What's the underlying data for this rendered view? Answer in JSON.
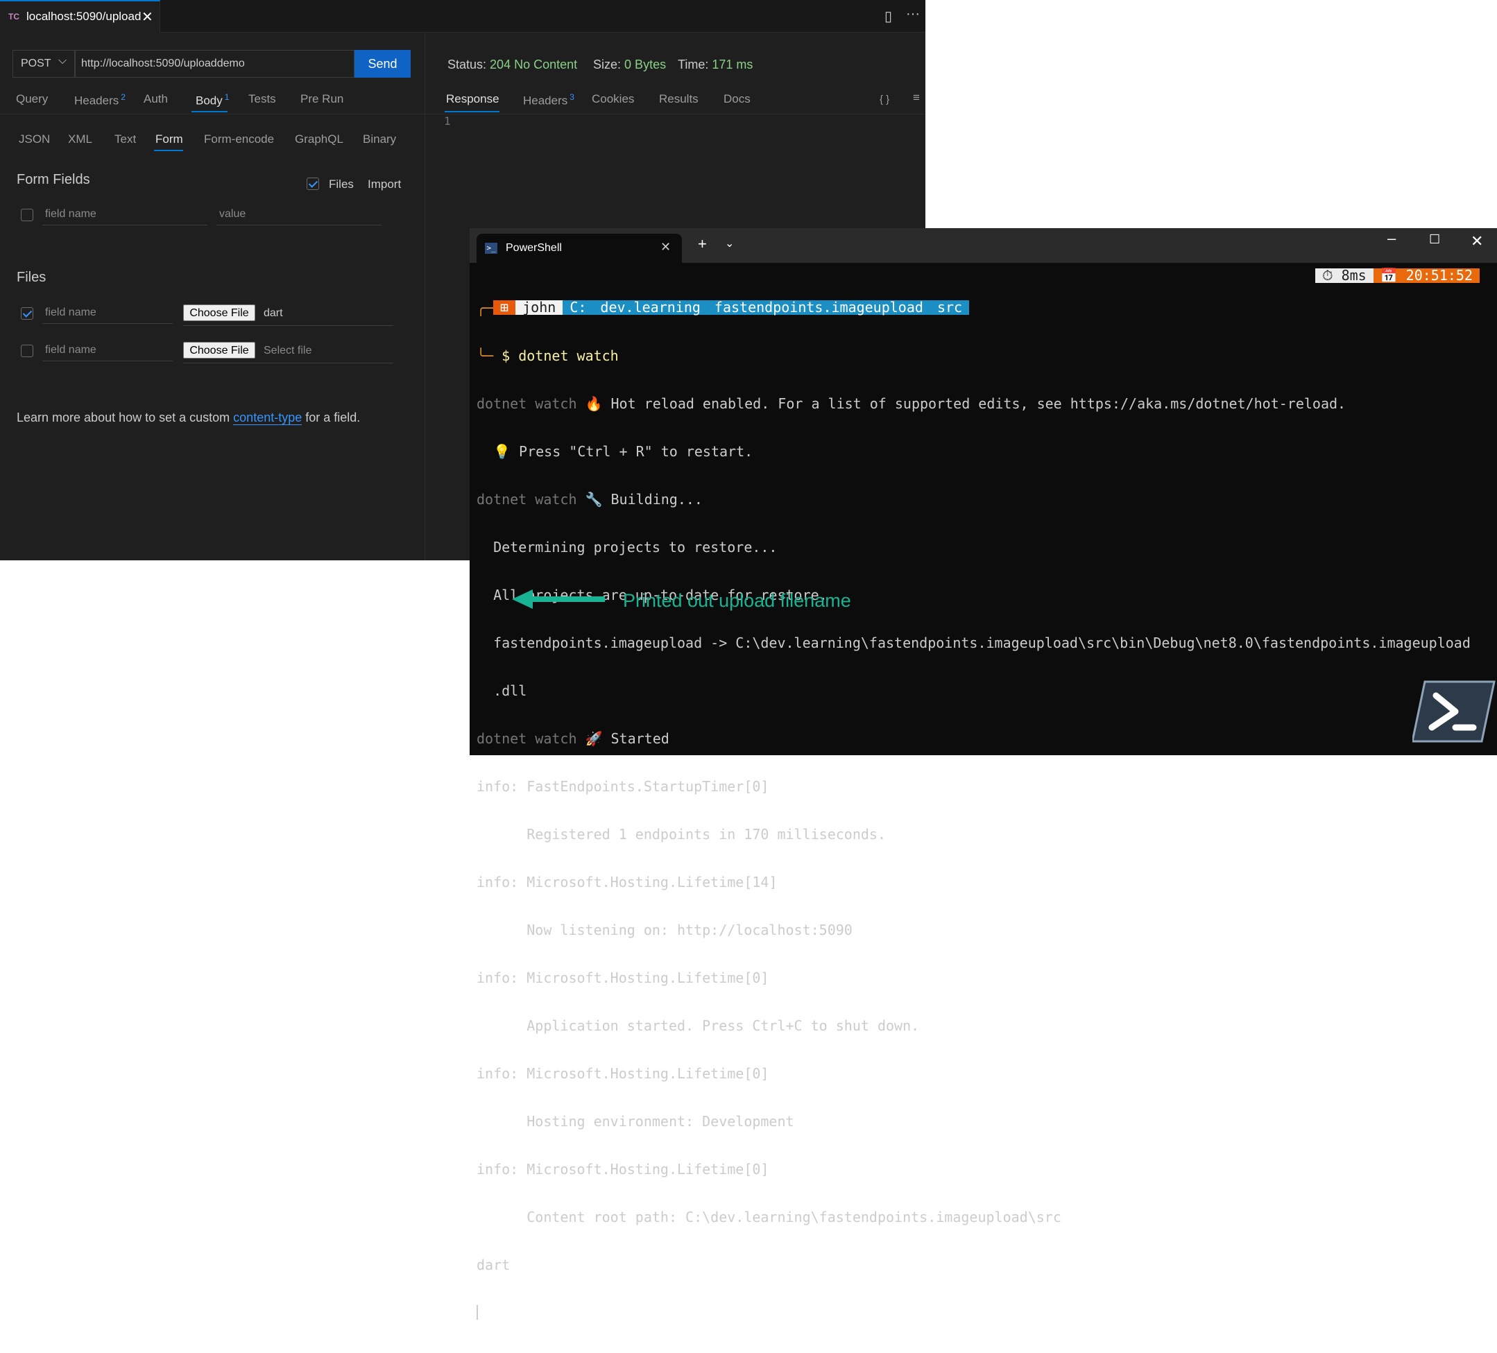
{
  "tab": {
    "logo": "TC",
    "title": "localhost:5090/upload"
  },
  "request": {
    "method": "POST",
    "url": "http://localhost:5090/uploaddemo",
    "send_label": "Send"
  },
  "req_tabs": [
    {
      "label": "Query",
      "count": ""
    },
    {
      "label": "Headers",
      "count": "2"
    },
    {
      "label": "Auth",
      "count": ""
    },
    {
      "label": "Body",
      "count": "1"
    },
    {
      "label": "Tests",
      "count": ""
    },
    {
      "label": "Pre Run",
      "count": ""
    }
  ],
  "body_tabs": [
    "JSON",
    "XML",
    "Text",
    "Form",
    "Form-encode",
    "GraphQL",
    "Binary"
  ],
  "form_fields": {
    "title": "Form Fields",
    "files_checkbox_label": "Files",
    "import_label": "Import",
    "name_placeholder": "field name",
    "value_placeholder": "value"
  },
  "files": {
    "title": "Files",
    "rows": [
      {
        "name_placeholder": "field name",
        "button": "Choose File",
        "file": "dart",
        "checked": true
      },
      {
        "name_placeholder": "field name",
        "button": "Choose File",
        "file": "Select file",
        "checked": false
      }
    ]
  },
  "learn": {
    "before": "Learn more about how to set a custom ",
    "link": "content-type",
    "after": " for a field."
  },
  "response": {
    "status_label": "Status:",
    "status_value": "204 No Content",
    "size_label": "Size:",
    "size_value": "0 Bytes",
    "time_label": "Time:",
    "time_value": "171 ms",
    "tabs": [
      {
        "label": "Response",
        "count": ""
      },
      {
        "label": "Headers",
        "count": "3"
      },
      {
        "label": "Cookies",
        "count": ""
      },
      {
        "label": "Results",
        "count": ""
      },
      {
        "label": "Docs",
        "count": ""
      }
    ],
    "json_icon": "{ }",
    "line_number": "1"
  },
  "terminal": {
    "tab_title": "PowerShell",
    "prompt": {
      "user": "john",
      "drive": "C:",
      "dirs": [
        "dev.learning",
        "fastendpoints.imageupload",
        "src"
      ],
      "duration": "8ms",
      "clock": "20:51:52"
    },
    "command": "dotnet watch",
    "lines": [
      {
        "dim": "dotnet watch",
        "text": " 🔥 Hot reload enabled. For a list of supported edits, see https://aka.ms/dotnet/hot-reload."
      },
      {
        "dim": "",
        "text": "  💡 Press \"Ctrl + R\" to restart."
      },
      {
        "dim": "dotnet watch",
        "text": " 🔧 Building..."
      },
      {
        "dim": "",
        "text": "  Determining projects to restore..."
      },
      {
        "dim": "",
        "text": "  All projects are up-to-date for restore."
      },
      {
        "dim": "",
        "text": "  fastendpoints.imageupload -> C:\\dev.learning\\fastendpoints.imageupload\\src\\bin\\Debug\\net8.0\\fastendpoints.imageupload"
      },
      {
        "dim": "",
        "text": "  .dll"
      },
      {
        "dim": "dotnet watch",
        "text": " 🚀 Started"
      },
      {
        "dim": "",
        "text": "info: FastEndpoints.StartupTimer[0]"
      },
      {
        "dim": "",
        "text": "      Registered 1 endpoints in 170 milliseconds."
      },
      {
        "dim": "",
        "text": "info: Microsoft.Hosting.Lifetime[14]"
      },
      {
        "dim": "",
        "text": "      Now listening on: http://localhost:5090"
      },
      {
        "dim": "",
        "text": "info: Microsoft.Hosting.Lifetime[0]"
      },
      {
        "dim": "",
        "text": "      Application started. Press Ctrl+C to shut down."
      },
      {
        "dim": "",
        "text": "info: Microsoft.Hosting.Lifetime[0]"
      },
      {
        "dim": "",
        "text": "      Hosting environment: Development"
      },
      {
        "dim": "",
        "text": "info: Microsoft.Hosting.Lifetime[0]"
      },
      {
        "dim": "",
        "text": "      Content root path: C:\\dev.learning\\fastendpoints.imageupload\\src"
      },
      {
        "dim": "",
        "text": "dart"
      }
    ]
  },
  "annotation": "Printed out upload filename",
  "colors": {
    "accent": "#0078d4",
    "send": "#0e63c4",
    "ok": "#89d185",
    "annotation": "#19b394"
  }
}
